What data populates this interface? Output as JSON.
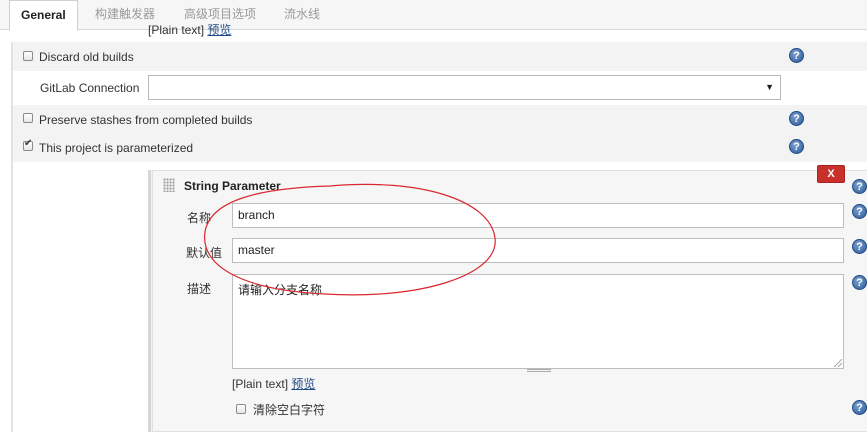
{
  "tabs": [
    {
      "label": "General"
    },
    {
      "label": "构建触发器"
    },
    {
      "label": "高级项目选项"
    },
    {
      "label": "流水线"
    }
  ],
  "top_desc": {
    "plain_text": "[Plain text]",
    "preview": "预览"
  },
  "options": {
    "discard_old_builds": {
      "label": "Discard old builds",
      "checked": false
    },
    "gitlab_connection": {
      "label": "GitLab Connection",
      "value": ""
    },
    "preserve_stashes": {
      "label": "Preserve stashes from completed builds",
      "checked": false
    },
    "parameterized": {
      "label": "This project is parameterized",
      "checked": true
    }
  },
  "help_icon": {
    "glyph": "?"
  },
  "string_parameter": {
    "title": "String Parameter",
    "delete_label": "X",
    "name_label": "名称",
    "name_value": "branch",
    "default_label": "默认值",
    "default_value": "master",
    "desc_label": "描述",
    "desc_value": "请输入分支名称",
    "plain_text": "[Plain text]",
    "preview": "预览",
    "trim_label": "清除空白字符",
    "trim_checked": false
  },
  "colors": {
    "help_blue": "#2c5a98",
    "delete_red": "#c9302c",
    "annotation_red": "#d9282f",
    "link_blue": "#204a87"
  }
}
